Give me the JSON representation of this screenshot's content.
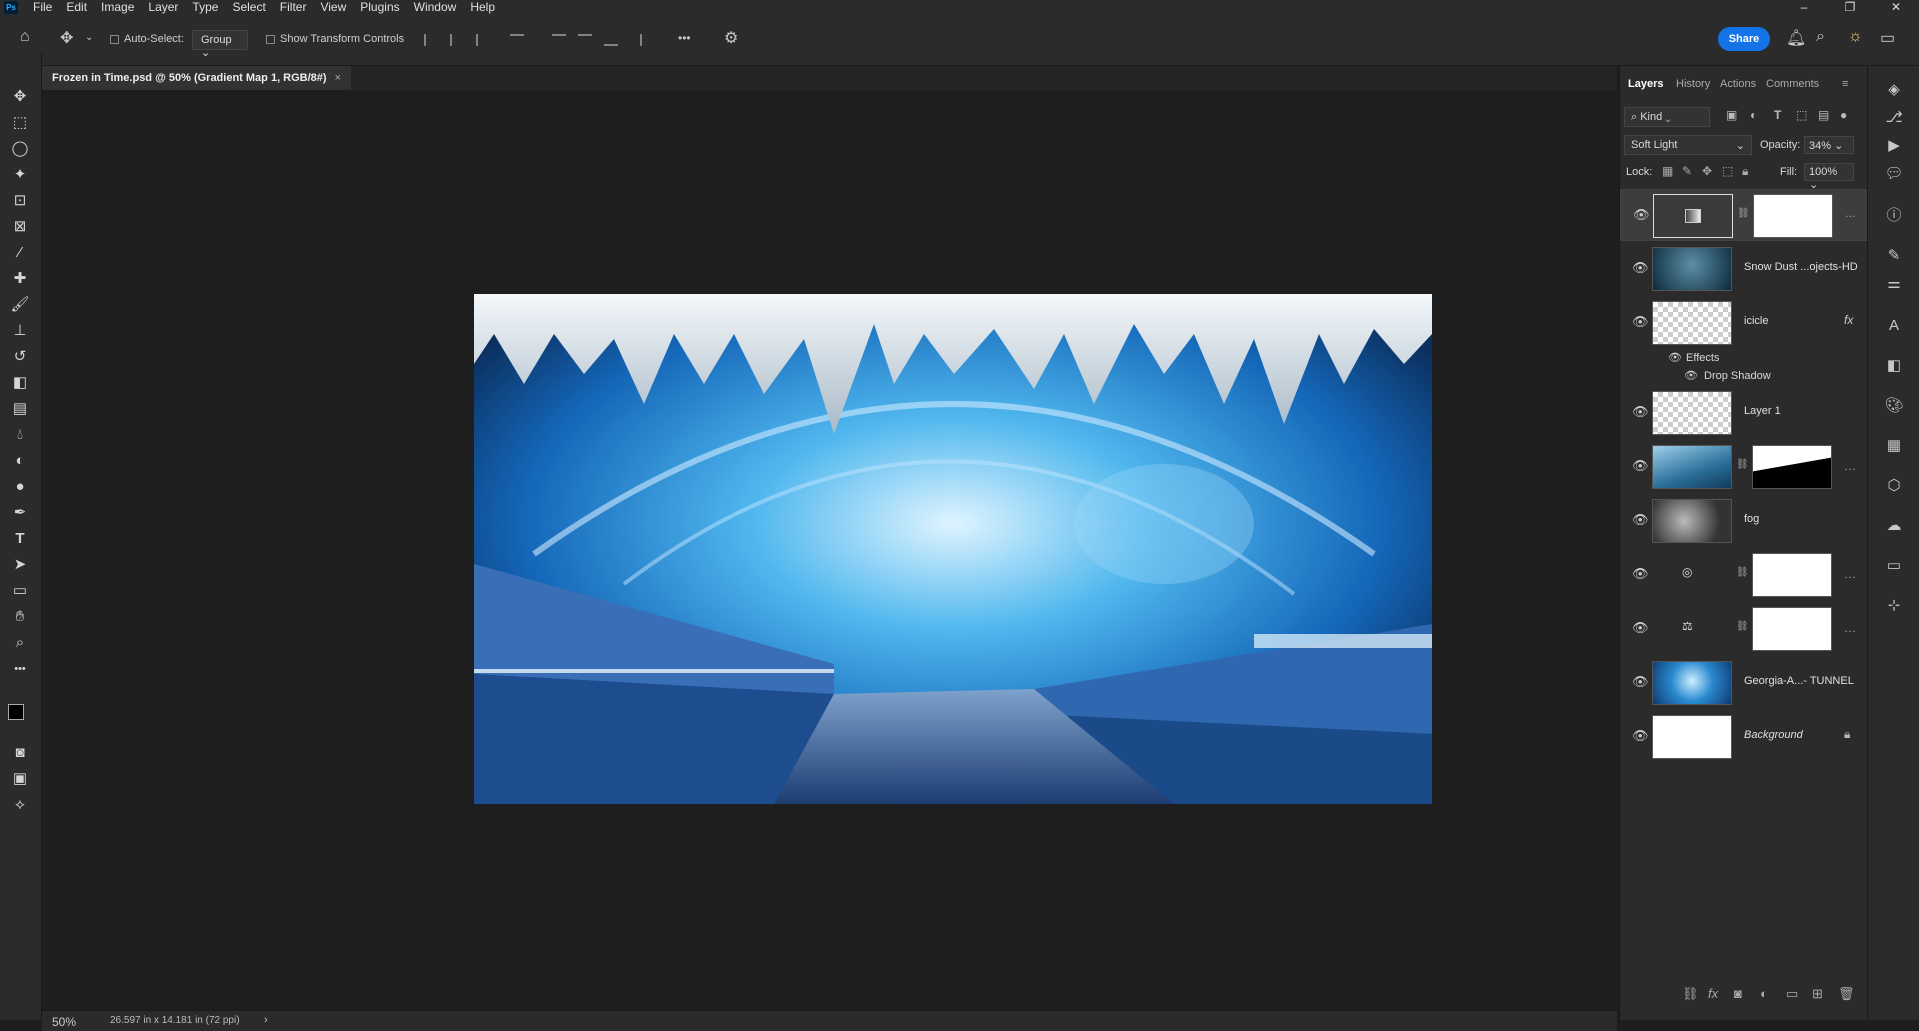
{
  "app": {
    "logo": "Ps"
  },
  "menu": [
    "File",
    "Edit",
    "Image",
    "Layer",
    "Type",
    "Select",
    "Filter",
    "View",
    "Plugins",
    "Window",
    "Help"
  ],
  "window_controls": {
    "minimize": "–",
    "restore": "❐",
    "close": "✕"
  },
  "options": {
    "auto_select_label": "Auto-Select:",
    "auto_select_value": "Group",
    "show_transform_label": "Show Transform Controls",
    "share_label": "Share",
    "more": "•••"
  },
  "document": {
    "tab_title": "Frozen in Time.psd @ 50% (Gradient Map 1, RGB/8#)",
    "close": "×",
    "zoom": "50%",
    "dimensions": "26.597 in x 14.181 in (72 ppi)",
    "status_arrow": "›"
  },
  "layers_panel": {
    "tabs": [
      "Layers",
      "History",
      "Actions",
      "Comments"
    ],
    "kind_label": "Kind",
    "blend_mode": "Soft Light",
    "opacity_label": "Opacity:",
    "opacity_value": "34%",
    "lock_label": "Lock:",
    "fill_label": "Fill:",
    "fill_value": "100%",
    "effects_label": "Effects",
    "drop_shadow_label": "Drop Shadow",
    "fx": "fx",
    "layers": [
      {
        "name": "",
        "type": "adjustment",
        "icon": "gradient-map-icon",
        "mask": "white",
        "selected": true
      },
      {
        "name": "Snow Dust ...ojects-HD",
        "type": "image",
        "thumb": "snow"
      },
      {
        "name": "icicle",
        "type": "image",
        "thumb": "checker",
        "fx": true
      },
      {
        "name": "Layer 1",
        "type": "image",
        "thumb": "checker"
      },
      {
        "name": "",
        "type": "image",
        "thumb": "water",
        "mask": "black-shape"
      },
      {
        "name": "fog",
        "type": "image",
        "thumb": "fog"
      },
      {
        "name": "",
        "type": "adjustment",
        "icon": "camera-raw-icon",
        "mask": "white"
      },
      {
        "name": "",
        "type": "adjustment",
        "icon": "balance-icon",
        "mask": "white"
      },
      {
        "name": "Georgia-A...- TUNNEL",
        "type": "image",
        "thumb": "tunnel"
      },
      {
        "name": "Background",
        "type": "background",
        "thumb": "white",
        "locked": true
      }
    ]
  },
  "colors": {
    "accent": "#1473e6",
    "panel": "#2b2b2b",
    "canvas_bg": "#1e1e1e"
  }
}
